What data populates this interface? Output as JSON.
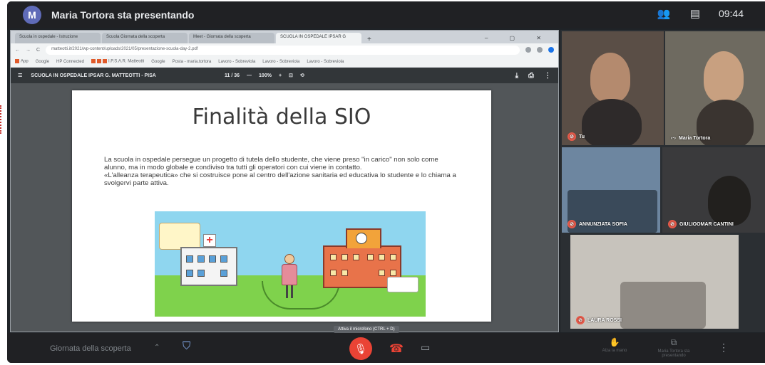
{
  "meet": {
    "avatar_letter": "M",
    "presenting_text": "Maria Tortora sta presentando",
    "clock": "09:44",
    "meeting_name": "Giornata della scoperta",
    "tooltip": "Attiva il microfono (CTRL + D)",
    "raise_hand_label": "Alza la mano",
    "present_label": "Maria Tortora sta presentando"
  },
  "browser": {
    "tabs": [
      "Scuola in ospedale - Istruzione",
      "Scuola Giornata della scoperta",
      "Meet - Giornata della scoperta",
      "SCUOLA IN OSPEDALE IPSAR G"
    ],
    "url": "matteotti.it/2021/wp-content/uploads/2021/05/presentazione-scuola-day-2.pdf",
    "bookmarks": [
      "App",
      "Google",
      "HP Connected",
      "I.P.S.A.R. Matteotti",
      "Google",
      "Posta - maria.tortora",
      "Lavoro - Sobreviola",
      "Lavoro - Sobreviola",
      "Lavoro - Sobreviola"
    ]
  },
  "pdf": {
    "doc_title": "SCUOLA IN OSPEDALE IPSAR G. MATTEOTTI - PISA",
    "page": "11 / 36",
    "zoom": "100%"
  },
  "slide": {
    "title": "Finalità della SIO",
    "paragraph1": "La scuola in ospedale persegue un progetto di tutela dello studente, che viene preso \"in carico\" non solo come alunno, ma in modo globale e condiviso tra tutti gli operatori con cui viene in contatto.",
    "paragraph2": "«L'alleanza terapeutica» che si costruisce pone al centro dell'azione sanitaria ed educativa lo studente e lo chiama a svolgervi parte attiva."
  },
  "participants": [
    {
      "name": "Tu"
    },
    {
      "name": "Maria Tortora"
    },
    {
      "name": "ANNUNZIATA SOFIA"
    },
    {
      "name": "GIULIOOMAR CANTINI"
    },
    {
      "name": "LAURA ROSSI"
    }
  ],
  "colors": {
    "meet_bar": "#202124",
    "mic_off": "#ea4335",
    "accent_blue": "#8ab4f8"
  }
}
